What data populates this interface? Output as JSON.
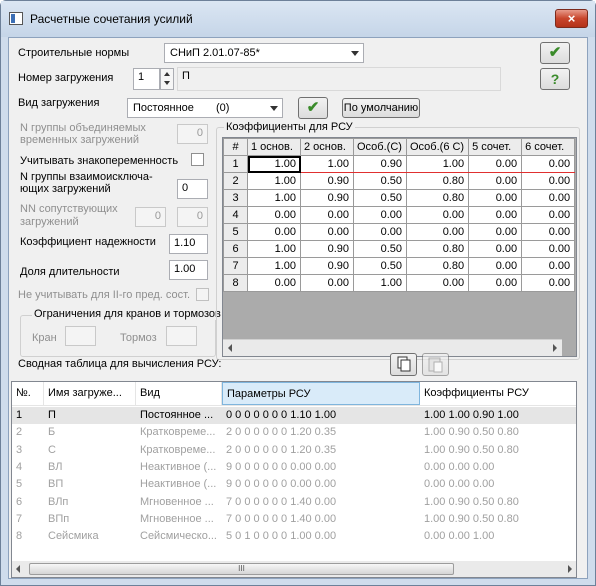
{
  "window": {
    "title": "Расчетные сочетания усилий",
    "close": "×"
  },
  "norms": {
    "label": "Строительные нормы",
    "value": "СНиП 2.01.07-85*"
  },
  "load_number": {
    "label": "Номер загружения",
    "value": "1",
    "name": "П"
  },
  "load_type": {
    "label": "Вид загружения",
    "value": "Постоянное",
    "code": "(0)",
    "default_button": "По умолчанию"
  },
  "params": {
    "group_combined": {
      "label1": "N группы объединяемых",
      "label2": "временных загружений",
      "value": "0"
    },
    "sign_variable": {
      "label": "Учитывать знакопеременность"
    },
    "group_exclusive": {
      "label1": "N группы взаимоисключа-",
      "label2": "ющих загружений",
      "value": "0"
    },
    "accompanying": {
      "label1": "NN сопутствующих",
      "label2": "загружений",
      "value1": "0",
      "value2": "0"
    },
    "reliability": {
      "label": "Коэффициент надежности",
      "value": "1.10"
    },
    "duration": {
      "label": "Доля длительности",
      "value": "1.00"
    },
    "ignore_2nd": {
      "label": "Не учитывать для II-го пред. сост."
    },
    "cranes": {
      "title": "Ограничения для кранов и тормозов",
      "crane_label": "Кран",
      "brake_label": "Тормоз"
    }
  },
  "coeffs": {
    "title": "Коэффициенты для РСУ",
    "columns": [
      "#",
      "1 основ.",
      "2 основ.",
      "Особ.(С)",
      "Особ.(6 С)",
      "5 сочет.",
      "6 сочет."
    ],
    "rows": [
      [
        "1",
        "1.00",
        "1.00",
        "0.90",
        "1.00",
        "0.00",
        "0.00"
      ],
      [
        "2",
        "1.00",
        "0.90",
        "0.50",
        "0.80",
        "0.00",
        "0.00"
      ],
      [
        "3",
        "1.00",
        "0.90",
        "0.50",
        "0.80",
        "0.00",
        "0.00"
      ],
      [
        "4",
        "0.00",
        "0.00",
        "0.00",
        "0.00",
        "0.00",
        "0.00"
      ],
      [
        "5",
        "0.00",
        "0.00",
        "0.00",
        "0.00",
        "0.00",
        "0.00"
      ],
      [
        "6",
        "1.00",
        "0.90",
        "0.50",
        "0.80",
        "0.00",
        "0.00"
      ],
      [
        "7",
        "1.00",
        "0.90",
        "0.50",
        "0.80",
        "0.00",
        "0.00"
      ],
      [
        "8",
        "0.00",
        "0.00",
        "1.00",
        "0.00",
        "0.00",
        "0.00"
      ]
    ]
  },
  "summary": {
    "title": "Сводная таблица для вычисления РСУ:",
    "columns": [
      "№.",
      "Имя загруже...",
      "Вид",
      "Параметры РСУ",
      "Коэффициенты РСУ"
    ],
    "rows": [
      [
        "1",
        "П",
        "Постоянное ...",
        "0 0 0 0 0 0 0 1.10 1.00",
        "1.00 1.00 0.90 1.00"
      ],
      [
        "2",
        "Б",
        "Кратковреме...",
        "2 0 0 0 0 0 0 1.20 0.35",
        "1.00 0.90 0.50 0.80"
      ],
      [
        "3",
        "С",
        "Кратковреме...",
        "2 0 0 0 0 0 0 1.20 0.35",
        "1.00 0.90 0.50 0.80"
      ],
      [
        "4",
        "ВЛ",
        "Неактивное (...",
        "9 0 0 0 0 0 0 0.00 0.00",
        "0.00 0.00 0.00"
      ],
      [
        "5",
        "ВП",
        "Неактивное (...",
        "9 0 0 0 0 0 0 0.00 0.00",
        "0.00 0.00 0.00"
      ],
      [
        "6",
        "ВЛп",
        "Мгновенное ...",
        "7 0 0 0 0 0 0 1.40 0.00",
        "1.00 0.90 0.50 0.80"
      ],
      [
        "7",
        "ВПп",
        "Мгновенное ...",
        "7 0 0 0 0 0 0 1.40 0.00",
        "1.00 0.90 0.50 0.80"
      ],
      [
        "8",
        "Сейсмика",
        "Сейсмическо...",
        "5 0 1 0 0 0 0 1.00 0.00",
        "0.00 0.00 1.00"
      ]
    ]
  },
  "icons": {
    "ok": "✔",
    "help": "?",
    "apply": "✔",
    "grip": "⁞",
    "thumb": "III"
  }
}
